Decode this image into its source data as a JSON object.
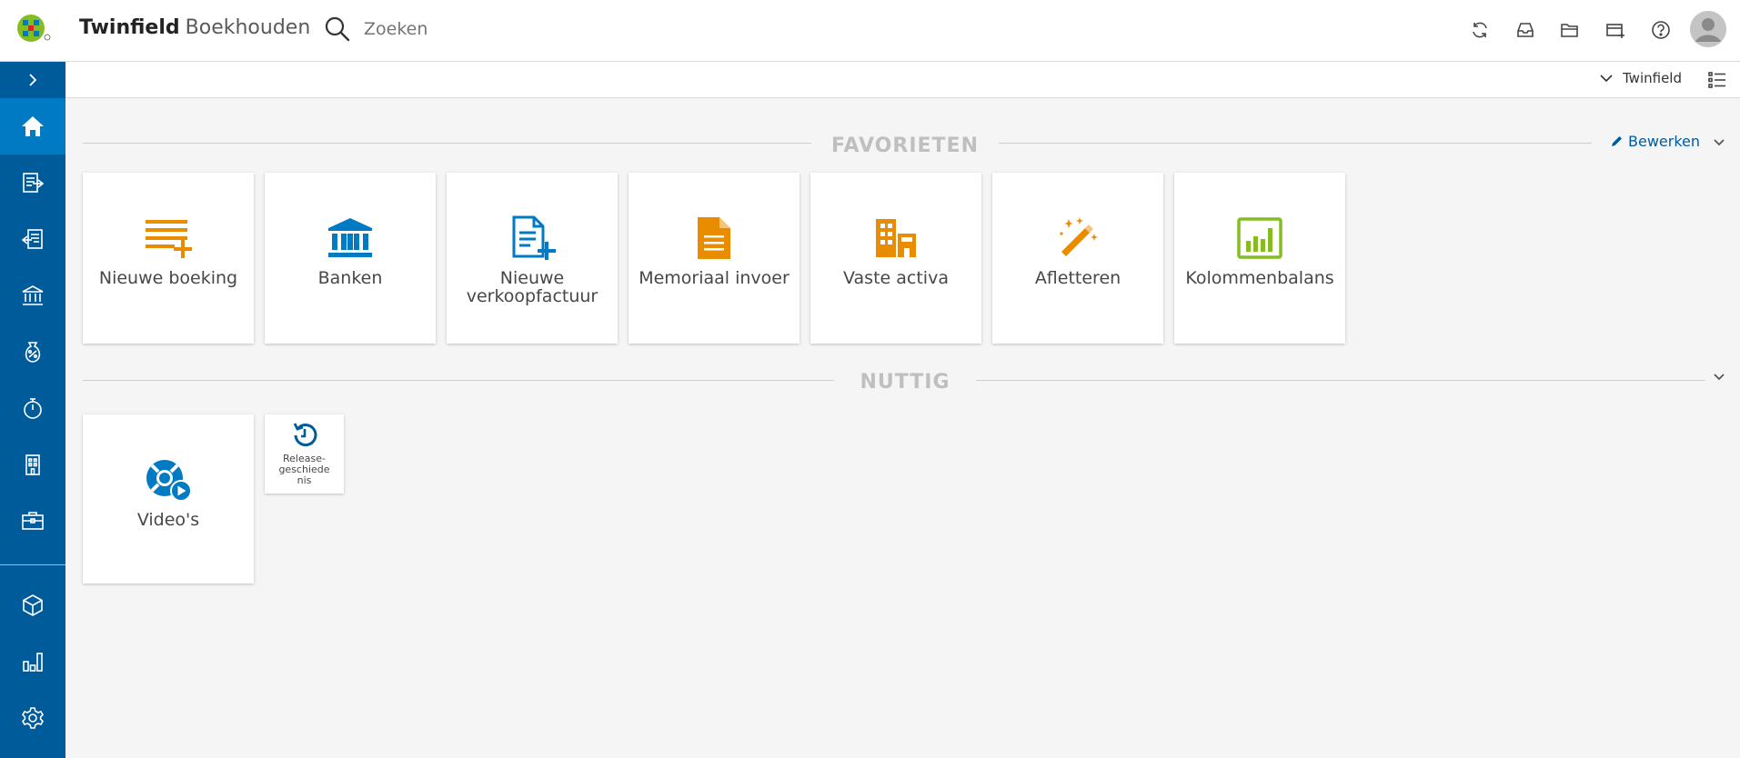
{
  "app": {
    "name": "Twinfield",
    "module": "Boekhouden"
  },
  "search": {
    "placeholder": "Zoeken"
  },
  "topbar_icons": [
    "refresh-icon",
    "inbox-icon",
    "folder-icon",
    "new-window-icon",
    "help-icon"
  ],
  "subbar": {
    "organisation": "Twinfield"
  },
  "sidebar": {
    "items": [
      {
        "name": "home",
        "icon": "home-icon",
        "active": true
      },
      {
        "name": "sales-invoices",
        "icon": "invoice-out-icon"
      },
      {
        "name": "purchase-invoices",
        "icon": "invoice-in-icon"
      },
      {
        "name": "banks",
        "icon": "bank-icon"
      },
      {
        "name": "vat",
        "icon": "percentage-icon"
      },
      {
        "name": "time",
        "icon": "stopwatch-icon"
      },
      {
        "name": "office",
        "icon": "building-icon"
      },
      {
        "name": "assets",
        "icon": "briefcase-icon"
      },
      {
        "name": "products",
        "icon": "cube-icon"
      },
      {
        "name": "reports",
        "icon": "bar-chart-icon"
      },
      {
        "name": "settings",
        "icon": "gear-icon"
      }
    ]
  },
  "favorites": {
    "title": "FAVORIETEN",
    "edit_label": "Bewerken",
    "tiles": [
      {
        "label": "Nieuwe boeking",
        "icon": "new-entry-icon",
        "color": "#ea8c00"
      },
      {
        "label": "Banken",
        "icon": "bank-icon",
        "color": "#007ac3"
      },
      {
        "label": "Nieuwe verkoopfactuur",
        "icon": "new-invoice-icon",
        "color": "#007ac3"
      },
      {
        "label": "Memoriaal invoer",
        "icon": "document-icon",
        "color": "#ea8c00"
      },
      {
        "label": "Vaste activa",
        "icon": "buildings-icon",
        "color": "#ea8c00"
      },
      {
        "label": "Afletteren",
        "icon": "magic-wand-icon",
        "color": "#ea8c00"
      },
      {
        "label": "Kolommenbalans",
        "icon": "column-chart-icon",
        "color": "#85bc20"
      }
    ]
  },
  "useful": {
    "title": "NUTTIG",
    "tiles": [
      {
        "label": "Video's",
        "icon": "lifebuoy-video-icon",
        "color": "#007ac3"
      },
      {
        "label": "Release-geschiedenis",
        "icon": "history-icon",
        "color": "#005b9b"
      }
    ]
  },
  "colors": {
    "sidebar": "#005b9b",
    "sidebar_active": "#007ac3",
    "accent": "#007ac3",
    "orange": "#ea8c00",
    "green": "#85bc20"
  }
}
